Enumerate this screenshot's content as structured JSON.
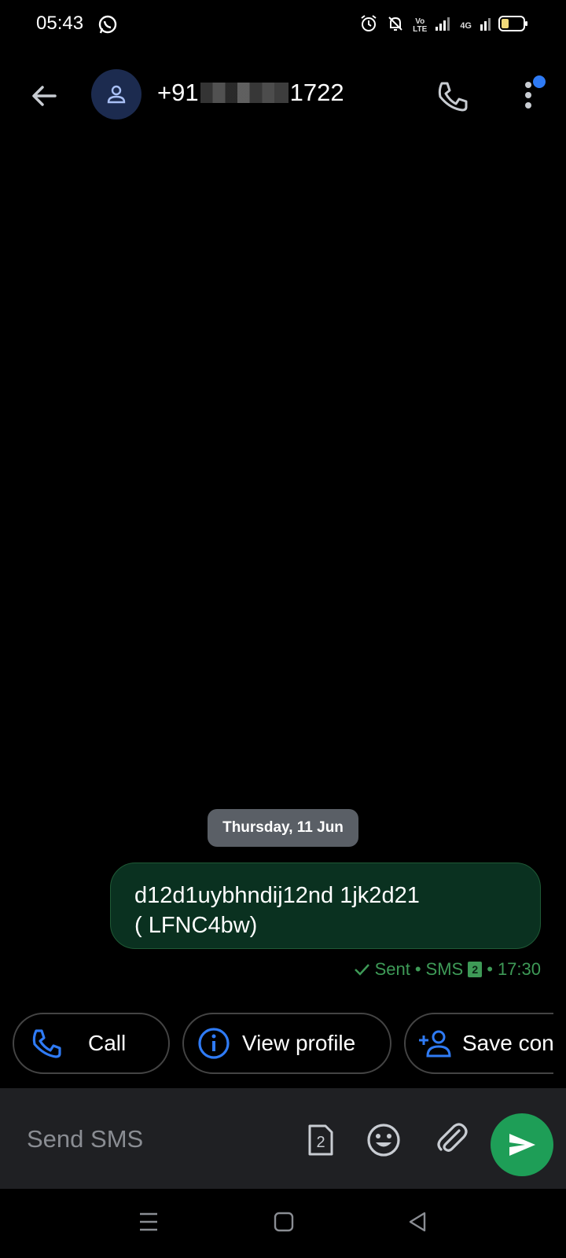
{
  "status_bar": {
    "time": "05:43",
    "network_label": "4G",
    "volte_line1": "Vo",
    "volte_line2": "LTE"
  },
  "header": {
    "title_prefix": "+91",
    "title_suffix": "1722"
  },
  "conversation": {
    "date_divider": "Thursday, 11 Jun",
    "messages": [
      {
        "line1": "d12d1uybhndij12nd 1jk2d21",
        "line2": "( LFNC4bw)",
        "status": "Sent",
        "channel": "SMS",
        "sim": "2",
        "time": "17:30"
      }
    ]
  },
  "chips": {
    "call": "Call",
    "view_profile": "View profile",
    "save_contact": "Save con"
  },
  "composer": {
    "placeholder": "Send SMS",
    "sim": "2"
  },
  "colors": {
    "accent_blue": "#2f7bf5",
    "sent_green": "#3e9a57",
    "send_button": "#1e9e57",
    "bubble_bg": "#0a3120"
  }
}
